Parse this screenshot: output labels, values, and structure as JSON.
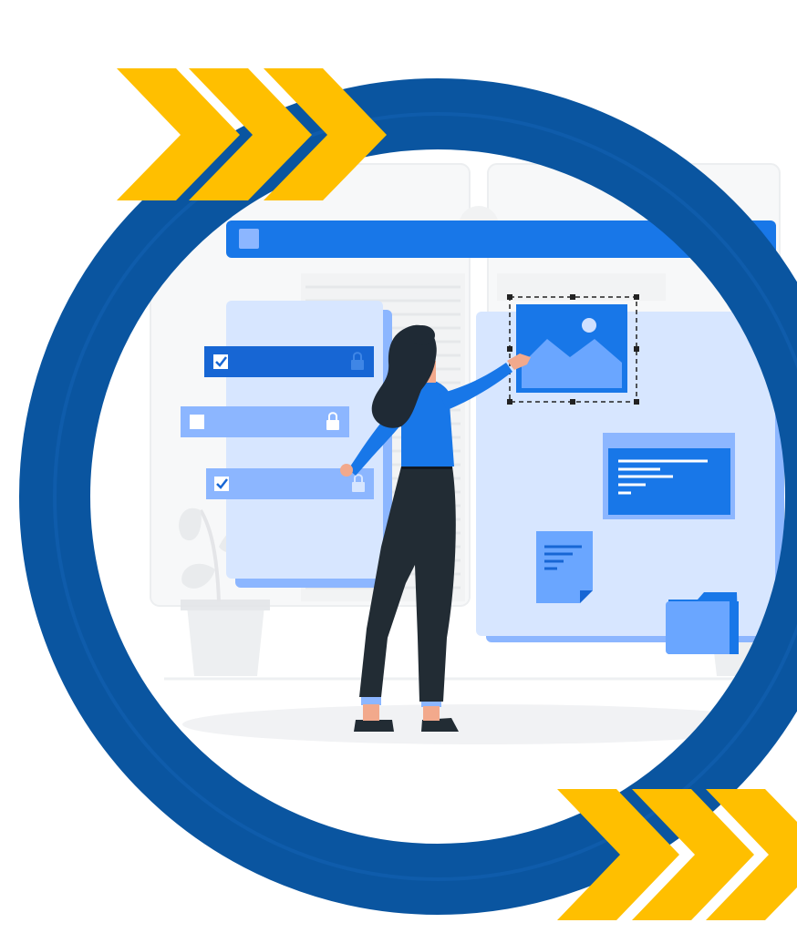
{
  "illustration": {
    "subject": "",
    "colors": {
      "ring": "#0a55a0",
      "chevron": "#ffbf00",
      "primary_blue": "#1877e8",
      "light_blue": "#d7e6ff",
      "mid_blue": "#8cb6ff",
      "dark_pants": "#222c34",
      "hair": "#1f2a35",
      "skin": "#f2a98c",
      "bg_gray": "#eef0f2"
    },
    "icons": [
      "chevron-right-icon",
      "checkbox-checked-icon",
      "checkbox-empty-icon",
      "lock-icon",
      "image-icon",
      "document-icon",
      "folder-icon",
      "more-dots-icon",
      "plant-icon"
    ]
  }
}
